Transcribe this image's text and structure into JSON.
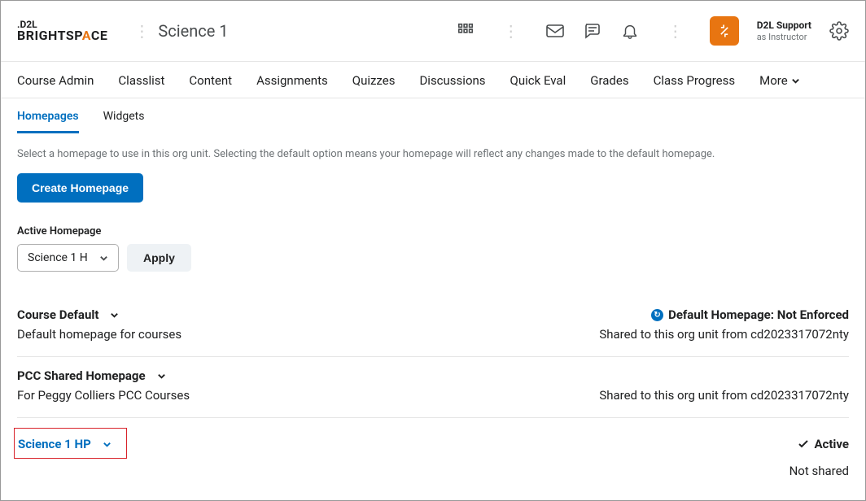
{
  "header": {
    "logo_top": ".D2L",
    "logo_bottom_1": "BRIGHTSP",
    "logo_bottom_2": "A",
    "logo_bottom_3": "CE",
    "course_title": "Science 1",
    "user_name": "D2L Support",
    "user_role": "as Instructor"
  },
  "mainnav": {
    "items": [
      "Course Admin",
      "Classlist",
      "Content",
      "Assignments",
      "Quizzes",
      "Discussions",
      "Quick Eval",
      "Grades",
      "Class Progress",
      "More"
    ]
  },
  "subnav": {
    "items": [
      "Homepages",
      "Widgets"
    ],
    "active_index": 0
  },
  "content": {
    "help_text": "Select a homepage to use in this org unit. Selecting the default option means your homepage will reflect any changes made to the default homepage.",
    "create_button": "Create Homepage",
    "active_label": "Active Homepage",
    "select_value": "Science 1 H",
    "apply_button": "Apply"
  },
  "homepages": [
    {
      "title": "Course Default",
      "desc": "Default homepage for courses",
      "status": "Default Homepage: Not Enforced",
      "status_icon": "info",
      "right_sub": "Shared to this org unit from cd2023317072nty",
      "linked": false,
      "highlighted": false
    },
    {
      "title": "PCC Shared Homepage",
      "desc": "For Peggy Colliers PCC Courses",
      "status": "",
      "right_sub": "Shared to this org unit from cd2023317072nty",
      "linked": false,
      "highlighted": false
    },
    {
      "title": "Science 1 HP",
      "desc": "",
      "status": "Active",
      "status_icon": "check",
      "right_sub": "Not shared",
      "linked": true,
      "highlighted": true
    }
  ]
}
